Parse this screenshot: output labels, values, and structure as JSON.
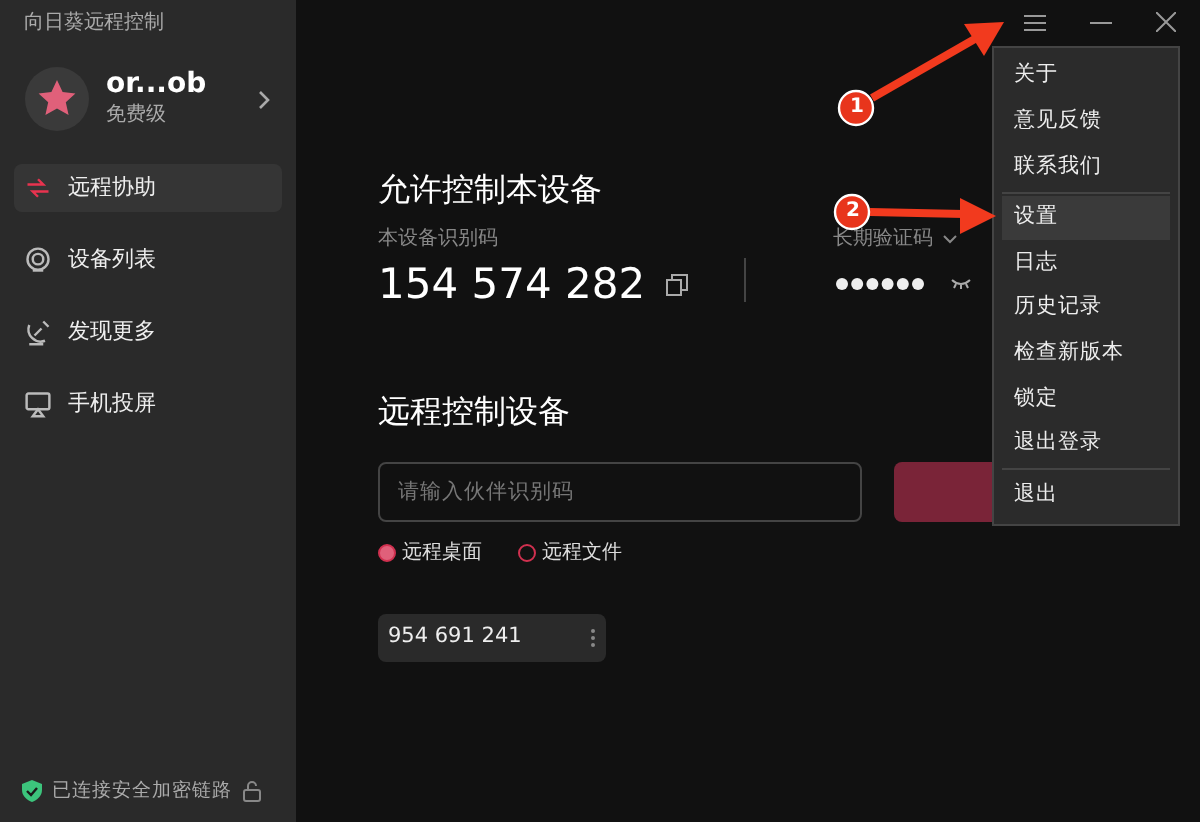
{
  "app_title": "向日葵远程控制",
  "user": {
    "name": "or...ob",
    "plan": "免费级"
  },
  "nav": [
    {
      "label": "远程协助",
      "selected": true
    },
    {
      "label": "设备列表",
      "selected": false
    },
    {
      "label": "发现更多",
      "selected": false
    },
    {
      "label": "手机投屏",
      "selected": false
    }
  ],
  "status": "已连接安全加密链路",
  "allow": {
    "heading": "允许控制本设备",
    "id_label": "本设备识别码",
    "id": "154 574 282",
    "code_label": "长期验证码"
  },
  "remote": {
    "heading": "远程控制设备",
    "placeholder": "请输入伙伴识别码",
    "modes": [
      {
        "label": "远程桌面",
        "selected": true
      },
      {
        "label": "远程文件",
        "selected": false
      }
    ],
    "recent": [
      "954 691 241"
    ]
  },
  "menu": {
    "groups": [
      [
        {
          "label": "关于",
          "selected": false
        },
        {
          "label": "意见反馈",
          "selected": false
        },
        {
          "label": "联系我们",
          "selected": false
        }
      ],
      [
        {
          "label": "设置",
          "selected": true
        },
        {
          "label": "日志",
          "selected": false
        },
        {
          "label": "历史记录",
          "selected": false
        },
        {
          "label": "检查新版本",
          "selected": false
        },
        {
          "label": "锁定",
          "selected": false
        },
        {
          "label": "退出登录",
          "selected": false
        }
      ],
      [
        {
          "label": "退出",
          "selected": false
        }
      ]
    ]
  },
  "annotations": [
    "1",
    "2"
  ]
}
